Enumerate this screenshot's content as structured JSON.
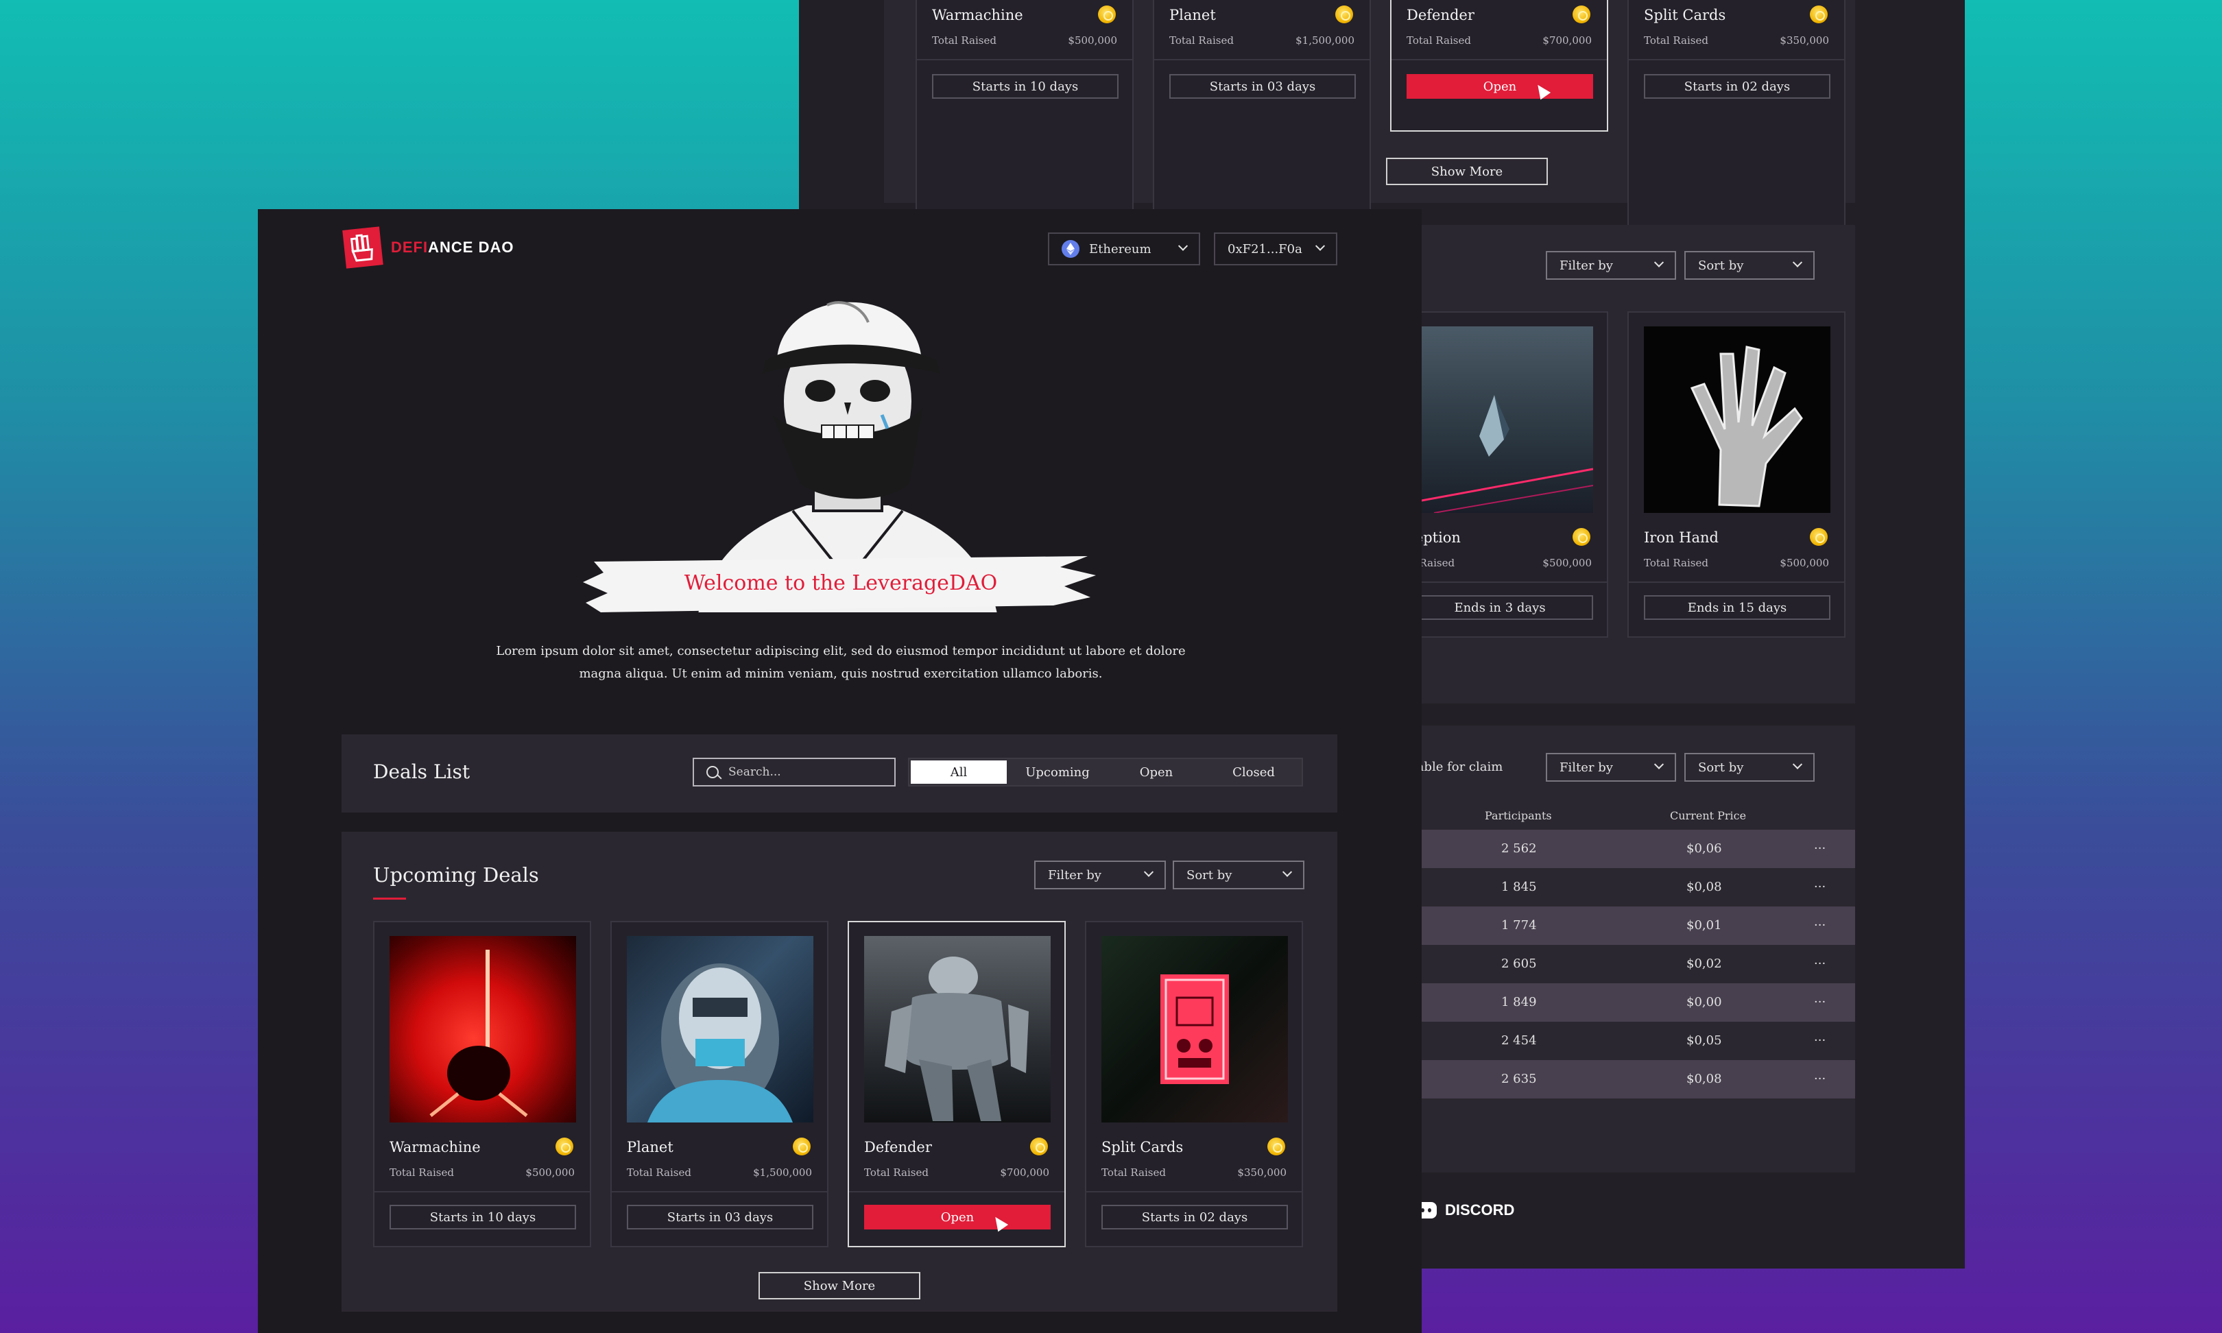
{
  "brand": {
    "name_accent": "DEFI",
    "name_rest": "ANCE DAO",
    "logo_icon": "fist-icon",
    "accent": "#e11d39"
  },
  "header": {
    "network": "Ethereum",
    "wallet": "0xF21...F0a"
  },
  "hero": {
    "title": "Welcome to the LeverageDAO",
    "body_line1": "Lorem ipsum dolor sit amet, consectetur adipiscing elit, sed do eiusmod tempor incididunt ut labore et dolore",
    "body_line2": "magna aliqua. Ut enim ad minim veniam, quis nostrud exercitation ullamco laboris."
  },
  "deals_list": {
    "title": "Deals List",
    "search_placeholder": "Search...",
    "tabs": [
      "All",
      "Upcoming",
      "Open",
      "Closed"
    ],
    "active_tab": "All"
  },
  "upcoming": {
    "title": "Upcoming Deals",
    "filter": "Filter by",
    "sort": "Sort by",
    "show_more": "Show More",
    "deals": [
      {
        "name": "Warmachine",
        "raised_label": "Total Raised",
        "raised": "$500,000",
        "action": "Starts in 10 days"
      },
      {
        "name": "Planet",
        "raised_label": "Total Raised",
        "raised": "$1,500,000",
        "action": "Starts in 03 days"
      },
      {
        "name": "Defender",
        "raised_label": "Total Raised",
        "raised": "$700,000",
        "action": "Open"
      },
      {
        "name": "Split Cards",
        "raised_label": "Total Raised",
        "raised": "$350,000",
        "action": "Starts in 02 days"
      }
    ]
  },
  "bg": {
    "deals": [
      {
        "name": "Warmachine",
        "raised_label": "Total Raised",
        "raised": "$500,000",
        "action": "Starts in 10 days"
      },
      {
        "name": "Planet",
        "raised_label": "Total Raised",
        "raised": "$1,500,000",
        "action": "Starts in 03 days"
      },
      {
        "name": "Defender",
        "raised_label": "Total Raised",
        "raised": "$700,000",
        "action": "Open"
      },
      {
        "name": "Split Cards",
        "raised_label": "Total Raised",
        "raised": "$350,000",
        "action": "Starts in 02 days"
      }
    ],
    "show_more": "Show More",
    "filter": "Filter by",
    "sort": "Sort by",
    "closed_deals": [
      {
        "name": "ception",
        "raised_label": "al Raised",
        "raised": "$500,000",
        "action": "Ends in 3 days"
      },
      {
        "name": "Iron Hand",
        "raised_label": "Total Raised",
        "raised": "$500,000",
        "action": "Ends in 15 days"
      }
    ],
    "claim": {
      "available": "Available for claim",
      "filter": "Filter by",
      "sort": "Sort by",
      "col_participants": "Participants",
      "col_price": "Current Price",
      "rows": [
        {
          "participants": "2 562",
          "price": "$0,06",
          "more": "···"
        },
        {
          "participants": "1 845",
          "price": "$0,08",
          "more": "···"
        },
        {
          "participants": "1 774",
          "price": "$0,01",
          "more": "···"
        },
        {
          "participants": "2 605",
          "price": "$0,02",
          "more": "···"
        },
        {
          "participants": "1 849",
          "price": "$0,00",
          "more": "···"
        },
        {
          "participants": "2 454",
          "price": "$0,05",
          "more": "···"
        },
        {
          "participants": "2 635",
          "price": "$0,08",
          "more": "···"
        }
      ]
    },
    "footer": {
      "discord": "DISCORD"
    }
  }
}
